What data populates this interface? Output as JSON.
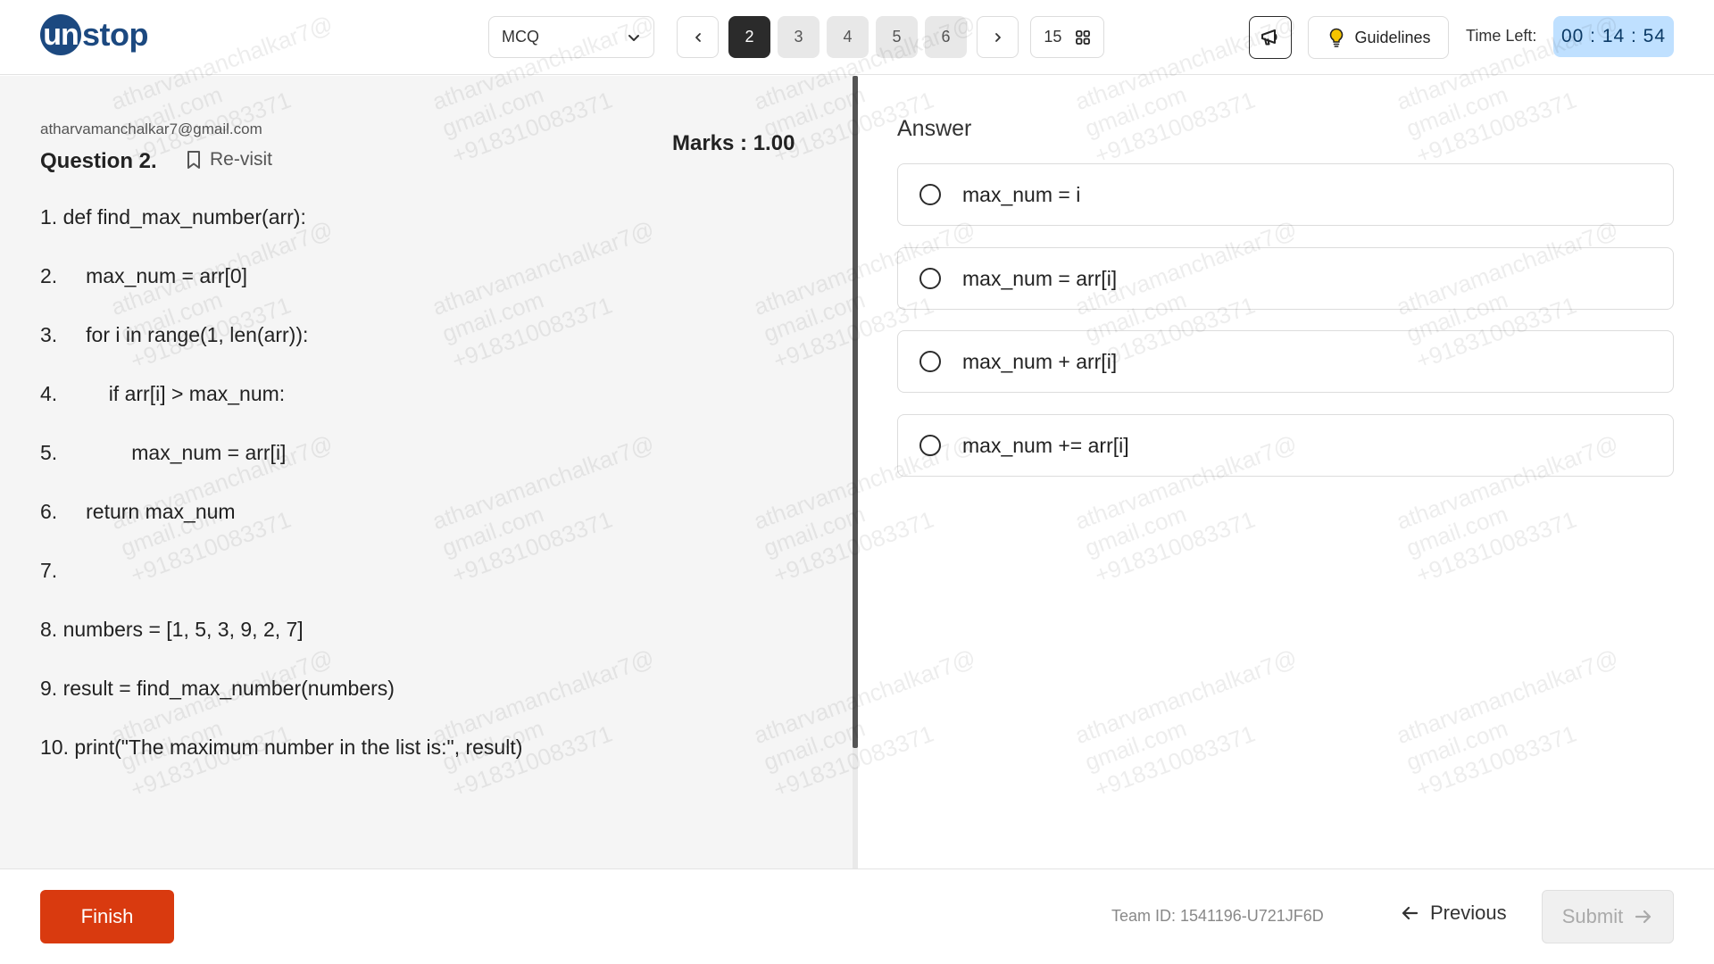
{
  "brand": {
    "logo_circle": "un",
    "logo_rest": "stop"
  },
  "header": {
    "section_select": "MCQ",
    "question_numbers": [
      {
        "label": "2",
        "state": "active"
      },
      {
        "label": "3",
        "state": "default"
      },
      {
        "label": "4",
        "state": "default"
      },
      {
        "label": "5",
        "state": "default"
      },
      {
        "label": "6",
        "state": "default"
      }
    ],
    "total_questions": "15",
    "guidelines_label": "Guidelines",
    "timer_label": "Time Left:",
    "timer_value": "00 : 14 : 54"
  },
  "question": {
    "user_email": "atharvamanchalkar7@gmail.com",
    "title": "Question 2.",
    "revisit_label": "Re-visit",
    "marks": "Marks : 1.00",
    "code_lines": [
      "1. def find_max_number(arr):",
      "2.     max_num = arr[0]",
      "3.     for i in range(1, len(arr)):",
      "4.         if arr[i] > max_num:",
      "5.             max_num = arr[i]",
      "6.     return max_num",
      "7.",
      "8. numbers = [1, 5, 3, 9, 2, 7]",
      "9. result = find_max_number(numbers)",
      "10. print(\"The maximum number in the list is:\", result)"
    ]
  },
  "answer": {
    "title": "Answer",
    "options": [
      "max_num = i",
      "max_num = arr[i]",
      "max_num + arr[i]",
      "max_num += arr[i]"
    ]
  },
  "footer": {
    "finish_label": "Finish",
    "team_id": "Team ID: 1541196-U721JF6D",
    "previous_label": "Previous",
    "submit_label": "Submit"
  },
  "watermark": "atharvamanchalkar7@\ngmail.com\n+918310083371",
  "colors": {
    "brand": "#1c4980",
    "finish": "#d93a0f",
    "timer_bg": "#bfe0ff",
    "active_question": "#2b2b2b"
  }
}
